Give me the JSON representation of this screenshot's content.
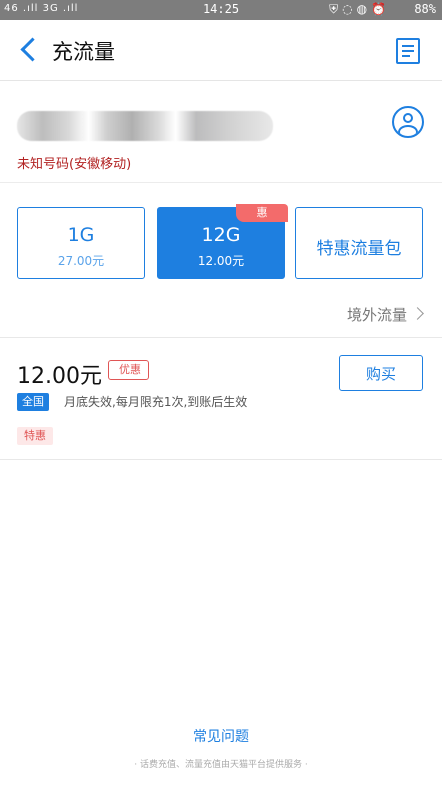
{
  "status_bar": {
    "signal": "46 .ıll 3G .ıll",
    "time": "14:25",
    "icons": [
      "shield",
      "nfc",
      "lock",
      "alarm"
    ],
    "battery": "88%"
  },
  "header": {
    "title": "充流量"
  },
  "account": {
    "carrier": "未知号码(安徽移动)"
  },
  "packages": [
    {
      "size": "1G",
      "price": "27.00元",
      "selected": false
    },
    {
      "size": "12G",
      "price": "12.00元",
      "selected": true,
      "badge": "惠"
    },
    {
      "label": "特惠流量包"
    }
  ],
  "overseas": {
    "label": "境外流量"
  },
  "detail": {
    "price": "12.00元",
    "discount_badge": "优惠",
    "buy_label": "购买",
    "scope_tag": "全国",
    "description": "月底失效,每月限充1次,到账后生效",
    "special_tag": "特惠"
  },
  "footer": {
    "faq": "常见问题",
    "note": "· 话费充值、流量充值由天猫平台提供服务 ·"
  },
  "colors": {
    "accent": "#1e7fe0",
    "alert": "#e05555",
    "status_bar": "#7d7d7d"
  }
}
